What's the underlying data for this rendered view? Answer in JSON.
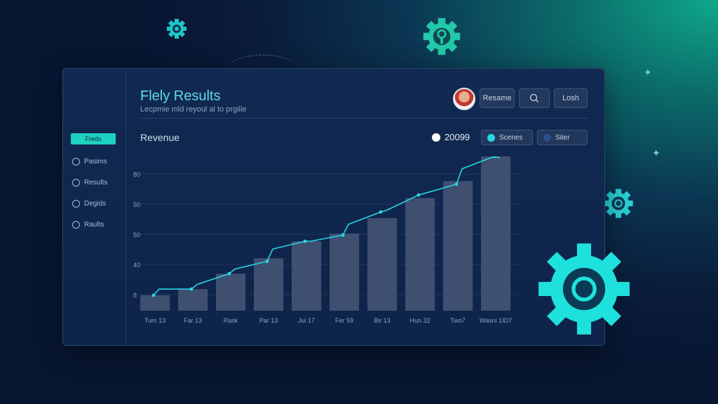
{
  "header": {
    "title": "Flely Results",
    "subtitle": "Lecpmie mld reyoul al to prgilie",
    "buttons": [
      "Resame",
      "Losh"
    ],
    "search_icon": "search-icon"
  },
  "sidebar": {
    "active_label": "Freds",
    "items": [
      {
        "label": "Pasims",
        "icon": "timer-icon"
      },
      {
        "label": "Results",
        "icon": "refresh-icon"
      },
      {
        "label": "Degids",
        "icon": "clock-icon"
      },
      {
        "label": "Raults",
        "icon": "shield-icon"
      }
    ]
  },
  "chart_panel": {
    "label": "Revenue",
    "legend_year": "20099",
    "legend_buttons": [
      "Scenes",
      "Siter"
    ]
  },
  "colors": {
    "accent": "#2ad6e6",
    "bar": "#3f4f70",
    "line": "#2ad6e6",
    "gear": "#18e0d8"
  },
  "chart_data": {
    "type": "bar",
    "title": "",
    "xlabel": "",
    "ylabel": "",
    "y_tick_labels": [
      "80",
      "50",
      "50",
      "40",
      "8"
    ],
    "categories": [
      "Tum 13",
      "Far 13",
      "Rask",
      "Par 13",
      "Jui 17",
      "Fer 59",
      "Bir 13",
      "Hun 32",
      "Two7",
      "Wasni 1ID7"
    ],
    "ylim": [
      0,
      100
    ],
    "series": [
      {
        "values": [
          10,
          14,
          24,
          34,
          45,
          50,
          60,
          73,
          84,
          100
        ]
      }
    ],
    "line_points": [
      {
        "x": 0,
        "y": 10
      },
      {
        "x": 0.5,
        "y": 14
      },
      {
        "x": 1,
        "y": 14
      },
      {
        "x": 1.5,
        "y": 17
      },
      {
        "x": 2,
        "y": 24
      },
      {
        "x": 2.5,
        "y": 27
      },
      {
        "x": 3,
        "y": 32
      },
      {
        "x": 3.5,
        "y": 40
      },
      {
        "x": 4,
        "y": 45
      },
      {
        "x": 4.5,
        "y": 45
      },
      {
        "x": 5,
        "y": 49
      },
      {
        "x": 5.5,
        "y": 56
      },
      {
        "x": 6,
        "y": 64
      },
      {
        "x": 6.5,
        "y": 65
      },
      {
        "x": 7,
        "y": 75
      },
      {
        "x": 7.5,
        "y": 76
      },
      {
        "x": 8,
        "y": 82
      },
      {
        "x": 8.5,
        "y": 92
      },
      {
        "x": 9,
        "y": 100
      },
      {
        "x": 9.5,
        "y": 99
      }
    ],
    "grid": true
  }
}
